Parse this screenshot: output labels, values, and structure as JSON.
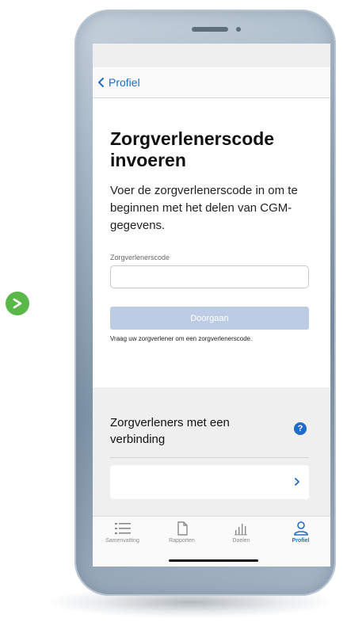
{
  "nav": {
    "back_label": "Profiel"
  },
  "main": {
    "title": "Zorgverlenerscode invoeren",
    "description": "Voer de zorgverlenerscode in om te beginnen met het delen van CGM-gegevens.",
    "field_label": "Zorgverlenerscode",
    "field_value": "",
    "field_placeholder": "",
    "continue_label": "Doorgaan",
    "helper_text": "Vraag uw zorgverlener om een zorgverlenerscode."
  },
  "connections": {
    "title": "Zorgverleners met een verbinding",
    "help_icon": "?"
  },
  "tabbar": {
    "items": [
      {
        "label": "Samenvatting",
        "icon": "list-icon",
        "active": false
      },
      {
        "label": "Rapporten",
        "icon": "document-icon",
        "active": false
      },
      {
        "label": "Doelen",
        "icon": "bar-chart-icon",
        "active": false
      },
      {
        "label": "Profiel",
        "icon": "person-icon",
        "active": true
      }
    ]
  },
  "colors": {
    "accent": "#1e6cc7",
    "button_disabled": "#bccce5",
    "badge_green": "#5ab74a"
  }
}
